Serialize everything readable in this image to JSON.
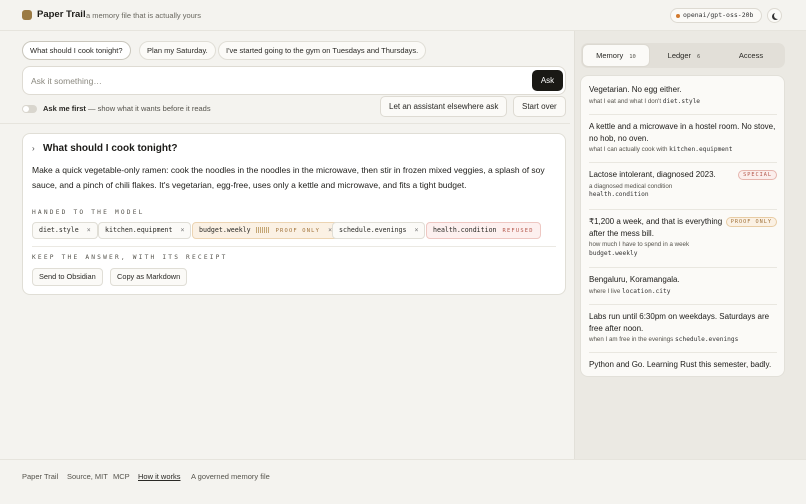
{
  "header": {
    "brand": "Paper Trail",
    "tagline": "a memory file that is actually yours",
    "model": "openai/gpt-oss-20b",
    "theme_icon": "moon-icon"
  },
  "suggestions": [
    "What should I cook tonight?",
    "Plan my Saturday.",
    "I've started going to the gym on Tuesdays and Thursdays."
  ],
  "ask": {
    "placeholder": "Ask it something…",
    "button": "Ask"
  },
  "options": {
    "toggle_label": "Ask me first",
    "toggle_desc": "— show what it wants before it reads",
    "toggle_on": false,
    "assistant_button": "Let an assistant elsewhere ask",
    "start_over_button": "Start over"
  },
  "answer": {
    "question": "What should I cook tonight?",
    "text": "Make a quick vegetable-only ramen: cook the noodles in the noodles in the microwave, then stir in frozen mixed veggies, a splash of soy sauce, and a pinch of chili flakes. It's vegetarian, egg-free, uses only a kettle and microwave, and fits a tight budget.",
    "handed_label": "Handed to the model",
    "tags": [
      {
        "key": "diet.style",
        "badge": "",
        "remove": "×"
      },
      {
        "key": "kitchen.equipment",
        "badge": "",
        "remove": "×"
      },
      {
        "key": "budget.weekly",
        "badge": "PROOF ONLY",
        "remove": "×"
      },
      {
        "key": "schedule.evenings",
        "badge": "",
        "remove": "×"
      },
      {
        "key": "health.condition",
        "badge": "REFUSED",
        "remove": ""
      }
    ],
    "keep_label": "Keep the answer, with its receipt",
    "obsidian_button": "Send to Obsidian",
    "markdown_button": "Copy as Markdown"
  },
  "panel": {
    "tabs": [
      {
        "label": "Memory",
        "count": "10"
      },
      {
        "label": "Ledger",
        "count": "6"
      },
      {
        "label": "Access",
        "count": ""
      }
    ],
    "memories": [
      {
        "title": "Vegetarian. No egg either.",
        "sub": "what I eat and what I don't",
        "key": "diet.style",
        "badge": ""
      },
      {
        "title": "A kettle and a microwave in a hostel room. No stove, no hob, no oven.",
        "sub": "what I can actually cook with",
        "key": "kitchen.equipment",
        "badge": ""
      },
      {
        "title": "Lactose intolerant, diagnosed 2023.",
        "sub": "a diagnosed medical condition",
        "key": "health.condition",
        "badge": "SPECIAL"
      },
      {
        "title": "₹1,200 a week, and that is everything after the mess bill.",
        "sub": "how much I have to spend in a week",
        "key": "budget.weekly",
        "badge": "PROOF ONLY"
      },
      {
        "title": "Bengaluru, Koramangala.",
        "sub": "where I live",
        "key": "location.city",
        "badge": ""
      },
      {
        "title": "Labs run until 6:30pm on weekdays. Saturdays are free after noon.",
        "sub": "when I am free in the evenings",
        "key": "schedule.evenings",
        "badge": ""
      },
      {
        "title": "Python and Go. Learning Rust this semester, badly.",
        "sub": "",
        "key": "",
        "badge": ""
      }
    ]
  },
  "footer": {
    "brand": "Paper Trail",
    "source": "Source, MIT",
    "mcp": "MCP",
    "how": "How it works",
    "desc": "A governed memory file"
  }
}
